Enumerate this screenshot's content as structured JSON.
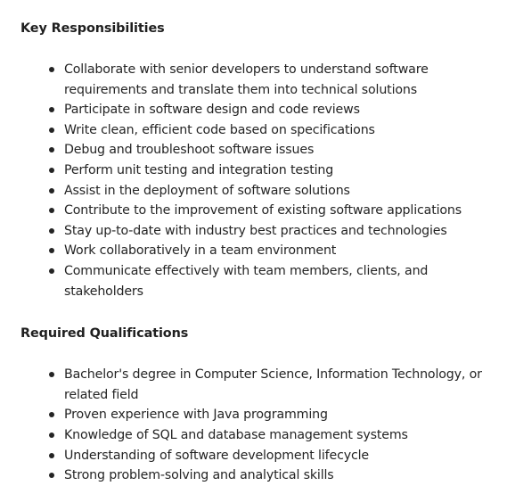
{
  "sections": [
    {
      "heading": "Key Responsibilities",
      "items": [
        "Collaborate with senior developers to understand software requirements and translate them into technical solutions",
        "Participate in software design and code reviews",
        "Write clean, efficient code based on specifications",
        "Debug and troubleshoot software issues",
        "Perform unit testing and integration testing",
        "Assist in the deployment of software solutions",
        "Contribute to the improvement of existing software applications",
        "Stay up-to-date with industry best practices and technologies",
        "Work collaboratively in a team environment",
        "Communicate effectively with team members, clients, and stakeholders"
      ]
    },
    {
      "heading": "Required Qualifications",
      "items": [
        "Bachelor's degree in Computer Science, Information Technology, or related field",
        "Proven experience with Java programming",
        "Knowledge of SQL and database management systems",
        "Understanding of software development lifecycle",
        "Strong problem-solving and analytical skills"
      ]
    }
  ]
}
